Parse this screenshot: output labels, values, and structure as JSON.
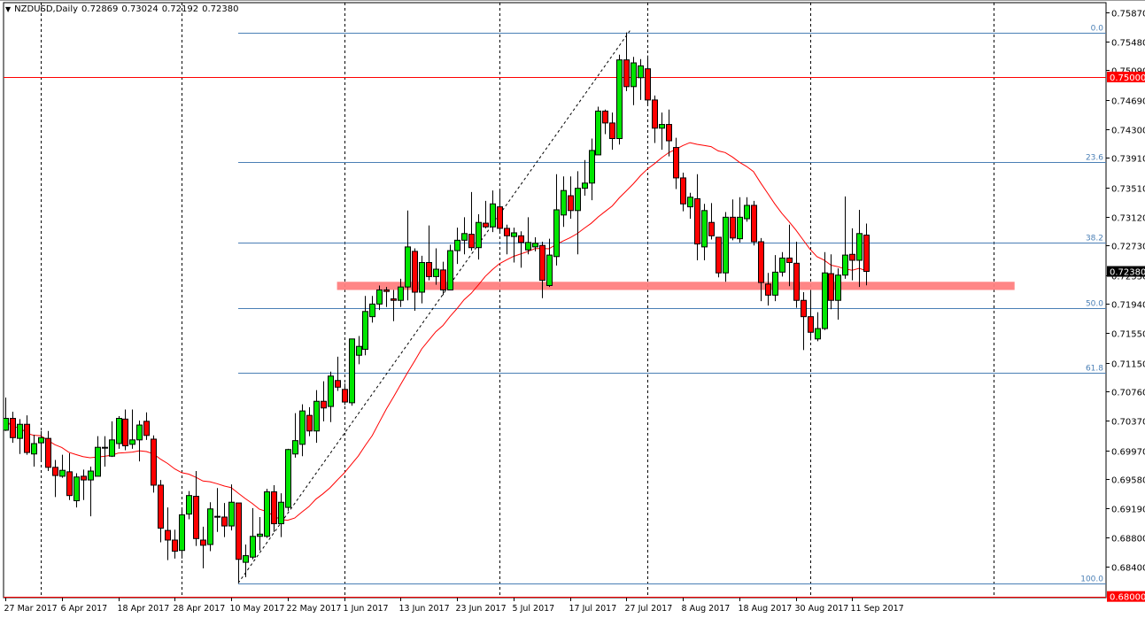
{
  "header": {
    "symbol": "NZDUSD,Daily",
    "open": "0.72869",
    "high": "0.73024",
    "low": "0.72192",
    "close": "0.72380"
  },
  "colors": {
    "bull": "#00e600",
    "bear": "#ff0000",
    "ma": "#ff0000",
    "fib": "#4a7fb5",
    "zone": "#ff8080",
    "level": "#ff0000",
    "last_price_tag": "#000000"
  },
  "chart_data": {
    "type": "candlestick",
    "title": "NZDUSD,Daily",
    "ylim": [
      0.6787,
      0.7604
    ],
    "y_ticks": [
      "0.75870",
      "0.75480",
      "0.75090",
      "0.74690",
      "0.74300",
      "0.73910",
      "0.73510",
      "0.73120",
      "0.72730",
      "0.72330",
      "0.71940",
      "0.71550",
      "0.71150",
      "0.70760",
      "0.70370",
      "0.69970",
      "0.69580",
      "0.69190",
      "0.68800",
      "0.68400"
    ],
    "x_labels": [
      "27 Mar 2017",
      "6 Apr 2017",
      "18 Apr 2017",
      "28 Apr 2017",
      "10 May 2017",
      "22 May 2017",
      "1 Jun 2017",
      "13 Jun 2017",
      "23 Jun 2017",
      "5 Jul 2017",
      "17 Jul 2017",
      "27 Jul 2017",
      "8 Aug 2017",
      "18 Aug 2017",
      "30 Aug 2017",
      "11 Sep 2017"
    ],
    "x_label_every_bars": 8,
    "period_separator_bars": [
      5,
      25,
      48,
      70,
      91,
      114,
      140
    ],
    "moving_average_period": 20,
    "ohlc": [
      [
        0.7024,
        0.7068,
        0.7023,
        0.704
      ],
      [
        0.704,
        0.7049,
        0.7007,
        0.7014
      ],
      [
        0.7013,
        0.7039,
        0.6992,
        0.7032
      ],
      [
        0.7032,
        0.7044,
        0.6991,
        0.6994
      ],
      [
        0.6992,
        0.7018,
        0.6975,
        0.7006
      ],
      [
        0.7007,
        0.7023,
        0.6984,
        0.7014
      ],
      [
        0.7013,
        0.7023,
        0.6969,
        0.6974
      ],
      [
        0.6974,
        0.6984,
        0.6934,
        0.6963
      ],
      [
        0.6962,
        0.6991,
        0.696,
        0.697
      ],
      [
        0.6968,
        0.6993,
        0.693,
        0.6936
      ],
      [
        0.6929,
        0.6966,
        0.692,
        0.6961
      ],
      [
        0.6962,
        0.6971,
        0.693,
        0.6957
      ],
      [
        0.6957,
        0.6975,
        0.6908,
        0.6969
      ],
      [
        0.6962,
        0.7016,
        0.6962,
        0.7001
      ],
      [
        0.7,
        0.7016,
        0.6975,
        0.7001
      ],
      [
        0.6989,
        0.7036,
        0.6988,
        0.7011
      ],
      [
        0.7006,
        0.7043,
        0.6999,
        0.704
      ],
      [
        0.7039,
        0.7052,
        0.6997,
        0.7003
      ],
      [
        0.7005,
        0.7052,
        0.6999,
        0.7011
      ],
      [
        0.7011,
        0.7037,
        0.6982,
        0.7031
      ],
      [
        0.7036,
        0.7048,
        0.7011,
        0.7017
      ],
      [
        0.7012,
        0.7017,
        0.694,
        0.695
      ],
      [
        0.695,
        0.6957,
        0.6873,
        0.6892
      ],
      [
        0.6889,
        0.692,
        0.6849,
        0.6876
      ],
      [
        0.6876,
        0.689,
        0.6851,
        0.6861
      ],
      [
        0.6862,
        0.692,
        0.6851,
        0.691
      ],
      [
        0.6911,
        0.6942,
        0.6904,
        0.6936
      ],
      [
        0.6935,
        0.6969,
        0.6868,
        0.6878
      ],
      [
        0.6876,
        0.6894,
        0.6838,
        0.6869
      ],
      [
        0.687,
        0.6927,
        0.6861,
        0.6918
      ],
      [
        0.6907,
        0.6946,
        0.6887,
        0.6908
      ],
      [
        0.6907,
        0.6926,
        0.688,
        0.6895
      ],
      [
        0.6895,
        0.6951,
        0.6889,
        0.6927
      ],
      [
        0.6926,
        0.6926,
        0.6818,
        0.685
      ],
      [
        0.6846,
        0.687,
        0.6826,
        0.6855
      ],
      [
        0.6853,
        0.6919,
        0.685,
        0.6881
      ],
      [
        0.6881,
        0.6907,
        0.6862,
        0.6884
      ],
      [
        0.6881,
        0.6945,
        0.6879,
        0.6941
      ],
      [
        0.6941,
        0.695,
        0.6887,
        0.6898
      ],
      [
        0.6898,
        0.6939,
        0.688,
        0.6927
      ],
      [
        0.692,
        0.6999,
        0.6915,
        0.6998
      ],
      [
        0.6992,
        0.7047,
        0.6987,
        0.701
      ],
      [
        0.7005,
        0.7059,
        0.6989,
        0.705
      ],
      [
        0.7044,
        0.7055,
        0.7016,
        0.7023
      ],
      [
        0.7023,
        0.7078,
        0.7007,
        0.7063
      ],
      [
        0.7063,
        0.709,
        0.7036,
        0.7054
      ],
      [
        0.7056,
        0.7103,
        0.7035,
        0.7097
      ],
      [
        0.7091,
        0.7123,
        0.7077,
        0.7082
      ],
      [
        0.7079,
        0.7087,
        0.7058,
        0.7062
      ],
      [
        0.7061,
        0.7147,
        0.7057,
        0.7147
      ],
      [
        0.7125,
        0.7151,
        0.7113,
        0.7137
      ],
      [
        0.7133,
        0.7205,
        0.7125,
        0.7184
      ],
      [
        0.7177,
        0.7205,
        0.7169,
        0.7194
      ],
      [
        0.7194,
        0.7219,
        0.7186,
        0.7213
      ],
      [
        0.7213,
        0.7217,
        0.719,
        0.7211
      ],
      [
        0.7201,
        0.7213,
        0.7171,
        0.7199
      ],
      [
        0.7199,
        0.7228,
        0.719,
        0.7217
      ],
      [
        0.7217,
        0.732,
        0.7199,
        0.7271
      ],
      [
        0.7265,
        0.7269,
        0.7185,
        0.721
      ],
      [
        0.721,
        0.7259,
        0.7195,
        0.725
      ],
      [
        0.725,
        0.73,
        0.7226,
        0.7231
      ],
      [
        0.7231,
        0.7269,
        0.722,
        0.7241
      ],
      [
        0.724,
        0.7251,
        0.7206,
        0.7213
      ],
      [
        0.7213,
        0.7274,
        0.7213,
        0.7266
      ],
      [
        0.7266,
        0.7297,
        0.7248,
        0.728
      ],
      [
        0.728,
        0.7311,
        0.7261,
        0.7289
      ],
      [
        0.7288,
        0.7345,
        0.7266,
        0.727
      ],
      [
        0.727,
        0.7315,
        0.7254,
        0.7304
      ],
      [
        0.7303,
        0.7333,
        0.7296,
        0.7298
      ],
      [
        0.7298,
        0.7347,
        0.7291,
        0.7329
      ],
      [
        0.7325,
        0.7348,
        0.7291,
        0.7296
      ],
      [
        0.7296,
        0.7301,
        0.7261,
        0.7286
      ],
      [
        0.7285,
        0.7297,
        0.725,
        0.729
      ],
      [
        0.7286,
        0.7292,
        0.7243,
        0.7277
      ],
      [
        0.7267,
        0.7311,
        0.7261,
        0.7277
      ],
      [
        0.7271,
        0.7284,
        0.7265,
        0.7276
      ],
      [
        0.7273,
        0.7278,
        0.7202,
        0.7226
      ],
      [
        0.7219,
        0.7282,
        0.7217,
        0.726
      ],
      [
        0.7258,
        0.7369,
        0.7246,
        0.7321
      ],
      [
        0.7314,
        0.7366,
        0.7298,
        0.7347
      ],
      [
        0.734,
        0.7366,
        0.7309,
        0.732
      ],
      [
        0.732,
        0.7373,
        0.7261,
        0.735
      ],
      [
        0.735,
        0.7388,
        0.734,
        0.7357
      ],
      [
        0.7357,
        0.7417,
        0.7334,
        0.7401
      ],
      [
        0.7395,
        0.746,
        0.7395,
        0.7454
      ],
      [
        0.7454,
        0.7456,
        0.7423,
        0.7438
      ],
      [
        0.7438,
        0.7452,
        0.7402,
        0.7417
      ],
      [
        0.7417,
        0.753,
        0.7409,
        0.7523
      ],
      [
        0.7523,
        0.756,
        0.7481,
        0.7487
      ],
      [
        0.7487,
        0.7527,
        0.7462,
        0.7519
      ],
      [
        0.7499,
        0.7524,
        0.7469,
        0.7515
      ],
      [
        0.7511,
        0.7529,
        0.7463,
        0.7469
      ],
      [
        0.7469,
        0.7475,
        0.7411,
        0.7431
      ],
      [
        0.7431,
        0.7452,
        0.7402,
        0.7436
      ],
      [
        0.7436,
        0.7456,
        0.7393,
        0.7414
      ],
      [
        0.7405,
        0.7418,
        0.7349,
        0.7364
      ],
      [
        0.7364,
        0.7371,
        0.7319,
        0.7329
      ],
      [
        0.7325,
        0.7344,
        0.7309,
        0.7338
      ],
      [
        0.7336,
        0.7369,
        0.7253,
        0.7275
      ],
      [
        0.7271,
        0.7329,
        0.7253,
        0.732
      ],
      [
        0.7304,
        0.733,
        0.7281,
        0.7286
      ],
      [
        0.7284,
        0.7284,
        0.723,
        0.7236
      ],
      [
        0.7236,
        0.7318,
        0.7224,
        0.7311
      ],
      [
        0.7311,
        0.7335,
        0.728,
        0.7283
      ],
      [
        0.7282,
        0.7338,
        0.7277,
        0.7311
      ],
      [
        0.7309,
        0.7338,
        0.7305,
        0.7327
      ],
      [
        0.7327,
        0.7333,
        0.7273,
        0.7278
      ],
      [
        0.7278,
        0.7283,
        0.7198,
        0.7223
      ],
      [
        0.7221,
        0.7236,
        0.7192,
        0.7206
      ],
      [
        0.7206,
        0.726,
        0.7198,
        0.7237
      ],
      [
        0.7237,
        0.7264,
        0.7231,
        0.7256
      ],
      [
        0.7256,
        0.7301,
        0.7218,
        0.725
      ],
      [
        0.7249,
        0.7278,
        0.7189,
        0.7199
      ],
      [
        0.7199,
        0.721,
        0.7132,
        0.7177
      ],
      [
        0.7177,
        0.7211,
        0.7145,
        0.7156
      ],
      [
        0.7147,
        0.7183,
        0.7144,
        0.7161
      ],
      [
        0.7161,
        0.7264,
        0.7159,
        0.7236
      ],
      [
        0.7235,
        0.7261,
        0.7187,
        0.7199
      ],
      [
        0.7199,
        0.7242,
        0.7173,
        0.7233
      ],
      [
        0.7233,
        0.7339,
        0.7228,
        0.726
      ],
      [
        0.7261,
        0.7296,
        0.7226,
        0.7253
      ],
      [
        0.7253,
        0.7321,
        0.7217,
        0.7289
      ],
      [
        0.72869,
        0.73024,
        0.72192,
        0.7238
      ]
    ],
    "fibonacci": {
      "start_bar": 33,
      "end_bar": 88,
      "high": 0.756,
      "low": 0.6818,
      "levels": [
        {
          "label": "0.0",
          "ratio": 0.0
        },
        {
          "label": "23.6",
          "ratio": 0.236
        },
        {
          "label": "38.2",
          "ratio": 0.382
        },
        {
          "label": "50.0",
          "ratio": 0.5
        },
        {
          "label": "61.8",
          "ratio": 0.618
        },
        {
          "label": "100.0",
          "ratio": 1.0
        }
      ]
    },
    "horizontal_levels": [
      {
        "price": 0.75,
        "label": "0.75000"
      },
      {
        "price": 0.68,
        "label": "0.68000"
      }
    ],
    "support_zone": {
      "from_bar": 47,
      "to_bar": 143,
      "low": 0.7213,
      "high": 0.7224
    },
    "last_price": {
      "price": 0.7238,
      "label": "0.72380"
    }
  }
}
